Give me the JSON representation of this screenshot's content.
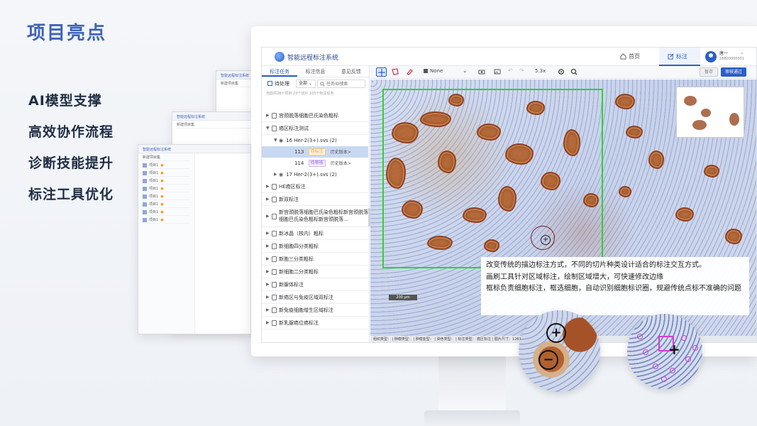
{
  "slide": {
    "title": "项目亮点",
    "features": [
      "AI模型支撑",
      "高效协作流程",
      "诊断技能提升",
      "标注工具优化"
    ]
  },
  "background_windows": [
    {
      "title": "智能远程标注系统",
      "rows": [
        "新建项目集",
        "项目1",
        "项目1",
        "项目1",
        "项目1",
        "项目1",
        "项目1",
        "项目1",
        "项目1"
      ]
    },
    {
      "title": "智能远程标注系统",
      "rows": [
        "新建项目集"
      ]
    },
    {
      "title": "智能远程标注系统",
      "rows": [
        "新建项目集"
      ]
    }
  ],
  "app": {
    "title": "智能远程标注系统",
    "nav": {
      "home": "首页",
      "annotate": "标注"
    },
    "user": {
      "name": "唐一",
      "phone": "18800000001"
    }
  },
  "left_panel": {
    "tabs": [
      "标注任务",
      "标注信息",
      "意见反馈"
    ],
    "pending_label": "待处理",
    "select_value": "全部",
    "search_placeholder": "任务ID搜索",
    "count_line": "当前共28个项目 23个切片 105个标注任务",
    "tree": {
      "item_cervical": "宫颈脱落细胞巴氏染色粗标",
      "item_tumor_test": "癌区标注测试",
      "slide_16": "16 Her-2(3+).svs (2)",
      "task_113": {
        "id": "113",
        "badge": "待标注",
        "history": "历史版本>"
      },
      "task_114": {
        "id": "114",
        "badge": "待审核",
        "history": "历史版本>"
      },
      "slide_17": "17 Her-2(3+).svs (2)",
      "items_after": [
        "HE癌区标注",
        "新双标注",
        "新宫颈脱落细胞巴氏染色粗标新宫颈脱落细胞巴氏染色粗标新宫颈脱落...",
        "新冰晶（核内）粗标",
        "新细胞四分类粗标",
        "新胞三分类粗标",
        "新细胞二分类粗标",
        "新腺体标注",
        "新癌区与免疫区域双标注",
        "新免疫细胞增生区域标注",
        "新乳腺癌位癌标注"
      ]
    }
  },
  "toolbar": {
    "color_select": "None",
    "zoom": "5.3x",
    "save_label": "暂存",
    "approve_label": "审核通过"
  },
  "viewer": {
    "scalebar": "200 μm",
    "callout_lines": [
      "改变传统的描边标注方式，不同的切片种类设计适合的标注交互方式。",
      "画刷工具针对区域标注，绘制区域增大，可快速修改边缘",
      "框标负责细胞标注，框选细胞，自动识别细胞标识圈，规避传统点标不准确的问题"
    ],
    "statusbar": "组织类型： | 肿瘤类型： | 肿瘤亚型： | 染色类型： | 标注类型： 癌区标注 | 图片尺寸：12614(39) x 1199 | 放大倍数： 20x"
  },
  "colors": {
    "accent": "#2c5fc6",
    "title_blue": "#3f63b8",
    "roi_green": "#2ed32e",
    "stain_brown": "#8b3a1c",
    "cell_ring": "#d23fd6"
  }
}
